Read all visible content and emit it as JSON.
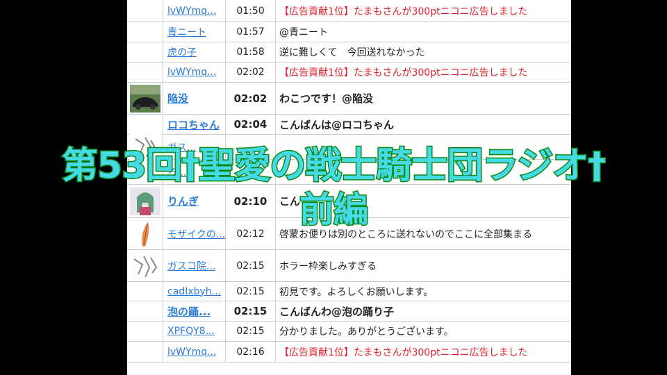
{
  "chat": {
    "rows": [
      {
        "user": "lvWYmq...",
        "time": "01:50",
        "msg": "【広告貢献1位】たまもさんが300ptニコニ広告しました",
        "ad": true,
        "bold": false,
        "icon": ""
      },
      {
        "user": "青ニート",
        "time": "01:57",
        "msg": "@青ニート",
        "ad": false,
        "bold": false,
        "icon": ""
      },
      {
        "user": "虎の子",
        "time": "01:58",
        "msg": "逆に難しくて　今回送れなかった",
        "ad": false,
        "bold": false,
        "icon": ""
      },
      {
        "user": "lvWYmq...",
        "time": "02:02",
        "msg": "【広告貢献1位】たまもさんが300ptニコニ広告しました",
        "ad": true,
        "bold": false,
        "icon": ""
      },
      {
        "user": "陥没",
        "time": "02:02",
        "msg": "わこつです！@陥没",
        "ad": false,
        "bold": true,
        "icon": "car-avatar-icon"
      },
      {
        "user": "ロコちゃん",
        "time": "02:04",
        "msg": "こんばんは@ロコちゃん",
        "ad": false,
        "bold": true,
        "icon": ""
      },
      {
        "user": "ガス...",
        "time": "",
        "msg": "",
        "ad": false,
        "bold": false,
        "icon": "sketch-avatar-icon"
      },
      {
        "user": "ろ...",
        "time": "",
        "msg": "",
        "ad": false,
        "bold": false,
        "icon": ""
      },
      {
        "user": "りんぎ",
        "time": "02:10",
        "msg": "こん",
        "ad": false,
        "bold": true,
        "icon": "anime-avatar-icon"
      },
      {
        "user": "モザイクの...",
        "time": "02:12",
        "msg": "啓蒙お便りは別のところに送れないのでここに全部集まる",
        "ad": false,
        "bold": false,
        "icon": "feather-avatar-icon"
      },
      {
        "user": "ガスコ院...",
        "time": "02:15",
        "msg": "ホラー枠楽しみすぎる",
        "ad": false,
        "bold": false,
        "icon": "sketch-avatar-icon"
      },
      {
        "user": "cadIxbyh...",
        "time": "02:15",
        "msg": "初見です。よろしくお願いします。",
        "ad": false,
        "bold": false,
        "icon": ""
      },
      {
        "user": "泡の踊...",
        "time": "02:15",
        "msg": "こんばんわ@泡の踊り子",
        "ad": false,
        "bold": true,
        "icon": ""
      },
      {
        "user": "XPFQY8...",
        "time": "02:15",
        "msg": "分かりました。ありがとうございます。",
        "ad": false,
        "bold": false,
        "icon": ""
      },
      {
        "user": "lvWYmq...",
        "time": "02:16",
        "msg": "【広告貢献1位】たまもさんが300ptニコニ広告しました",
        "ad": true,
        "bold": false,
        "icon": ""
      }
    ]
  },
  "overlay": {
    "title_line1": "第53回†聖愛の戦士騎士団ラジオ†",
    "title_line2": "前編",
    "fill_color": "#46d9e6",
    "stroke_color": "#0b8a16"
  }
}
